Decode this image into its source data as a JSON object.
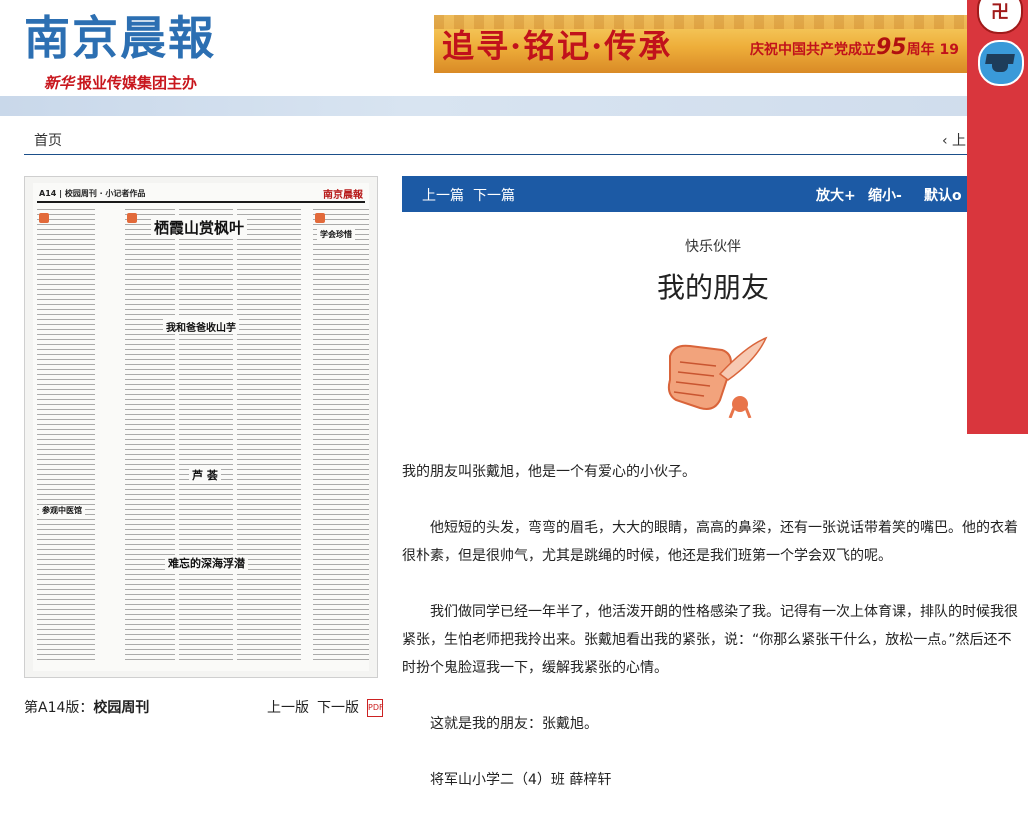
{
  "header": {
    "logo": "南京晨報",
    "publisher_mark": "新华",
    "publisher": "报业传媒集团主办",
    "banner_slogan": "追寻·铭记·传承",
    "banner_text_prefix": "庆祝中国共产党成立",
    "banner_number": "95",
    "banner_text_suffix": "周年 19"
  },
  "nav": {
    "home": "首页",
    "prev": "‹ 上"
  },
  "thumbnail": {
    "header_label": "A14 | 校园周刊 · 小记者作品",
    "header_brand": "南京晨報",
    "headlines": [
      "栖霞山赏枫叶",
      "我和爸爸收山芋",
      "芦 荟",
      "难忘的深海浮潜",
      "参观中医馆",
      "学会珍惜"
    ]
  },
  "page_caption": {
    "label": "第A14版：",
    "section": "校园周刊",
    "prev_page": "上一版",
    "next_page": "下一版",
    "pdf": "PDF"
  },
  "toolbar": {
    "prev": "上一篇",
    "next": "下一篇",
    "zoom_in": "放大+",
    "zoom_out": "缩小-",
    "reset": "默认o"
  },
  "article": {
    "kicker": "快乐伙伴",
    "title": "我的朋友",
    "paragraphs": [
      "我的朋友叫张戴旭，他是一个有爱心的小伙子。",
      "他短短的头发，弯弯的眉毛，大大的眼睛，高高的鼻梁，还有一张说话带着笑的嘴巴。他的衣着很朴素，但是很帅气，尤其是跳绳的时候，他还是我们班第一个学会双飞的呢。",
      "我们做同学已经一年半了，他活泼开朗的性格感染了我。记得有一次上体育课，排队的时候我很紧张，生怕老师把我拎出来。张戴旭看出我的紧张，说：“你那么紧张干什么，放松一点。”然后还不时扮个鬼脸逗我一下，缓解我紧张的心情。",
      "这就是我的朋友：张戴旭。",
      "将军山小学二（4）班 薛梓轩"
    ]
  },
  "float_panel": {
    "top_icon": "卍"
  },
  "colors": {
    "brand_blue": "#1c5aa5",
    "logo_blue": "#2c6fb2",
    "banner_red": "#c1121b",
    "float_red": "#d9363d"
  }
}
